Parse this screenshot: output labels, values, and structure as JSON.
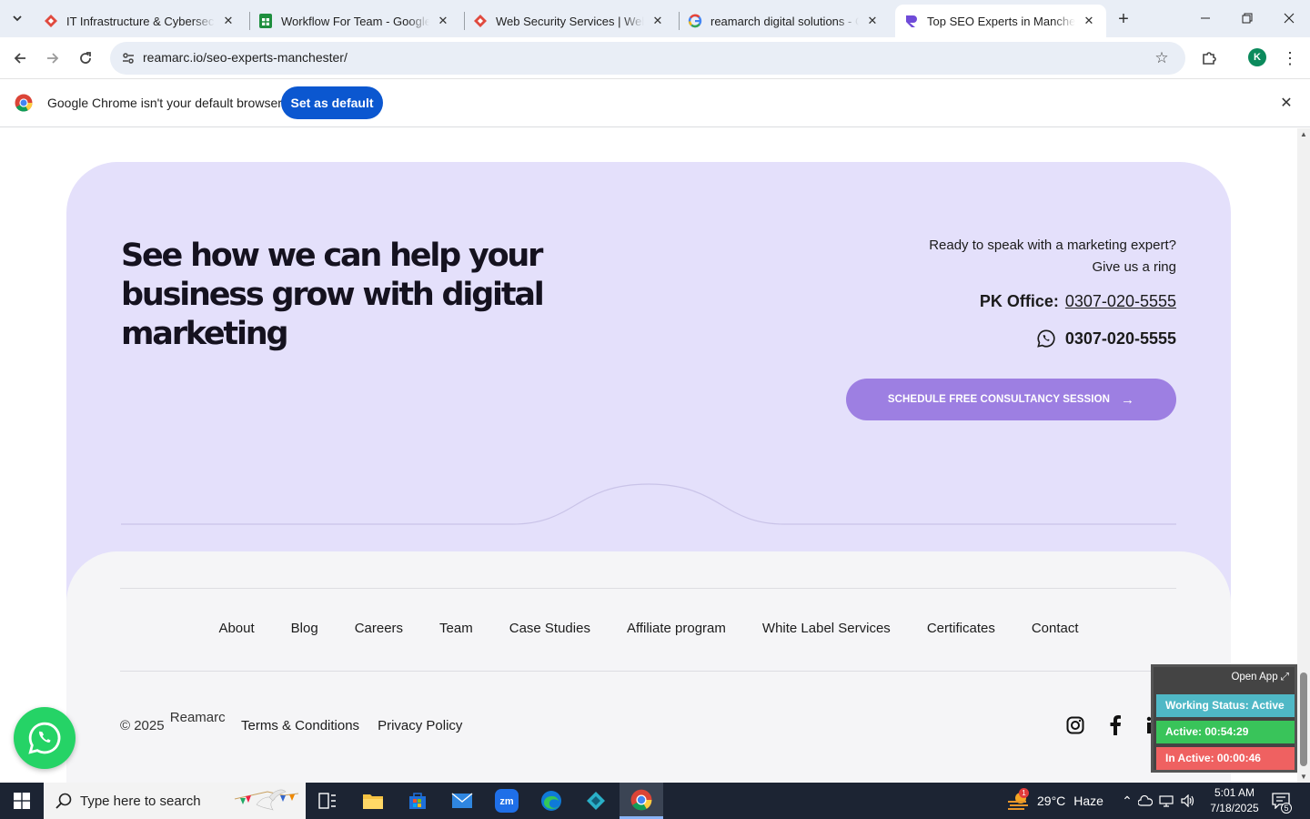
{
  "browser": {
    "tabs": [
      {
        "title": "IT Infrastructure & Cybersecurit"
      },
      {
        "title": "Workflow For Team - Google Sh"
      },
      {
        "title": "Web Security Services | Website"
      },
      {
        "title": "reamarch digital solutions - Go"
      },
      {
        "title": "Top SEO Experts in Mancheste"
      }
    ],
    "url": "reamarc.io/seo-experts-manchester/",
    "profile_initial": "K",
    "colors": {
      "tabstrip": "#e9eef6",
      "accent": "#0b57d0"
    }
  },
  "infobar": {
    "message": "Google Chrome isn't your default browser",
    "button": "Set as default"
  },
  "cta": {
    "headline": "See how we can help your business grow with digital marketing",
    "ready_text": "Ready to speak with a marketing expert? Give us a ring",
    "pk_label": "PK Office:",
    "pk_number": "0307-020-5555",
    "whatsapp_number": "0307-020-5555",
    "button": "SCHEDULE FREE CONSULTANCY SESSION",
    "colors": {
      "panel": "#e4e0fb",
      "button": "#9d7fe2"
    }
  },
  "footer": {
    "nav": [
      "About",
      "Blog",
      "Careers",
      "Team",
      "Case Studies",
      "Affiliate program",
      "White Label Services",
      "Certificates",
      "Contact"
    ],
    "copyright": "© 2025",
    "brand": "Reamarc",
    "legal": [
      "Terms & Conditions",
      "Privacy Policy"
    ],
    "social": [
      "instagram-icon",
      "facebook-icon",
      "linkedin-icon"
    ]
  },
  "tracker": {
    "open_app": "Open App",
    "status": "Working Status: Active",
    "active": "Active: 00:54:29",
    "inactive": "In Active: 00:00:46"
  },
  "taskbar": {
    "search_placeholder": "Type here to search",
    "weather_temp": "29°C",
    "weather_text": "Haze",
    "weather_badge": "1",
    "time": "5:01 AM",
    "date": "7/18/2025",
    "notifications": "5"
  }
}
